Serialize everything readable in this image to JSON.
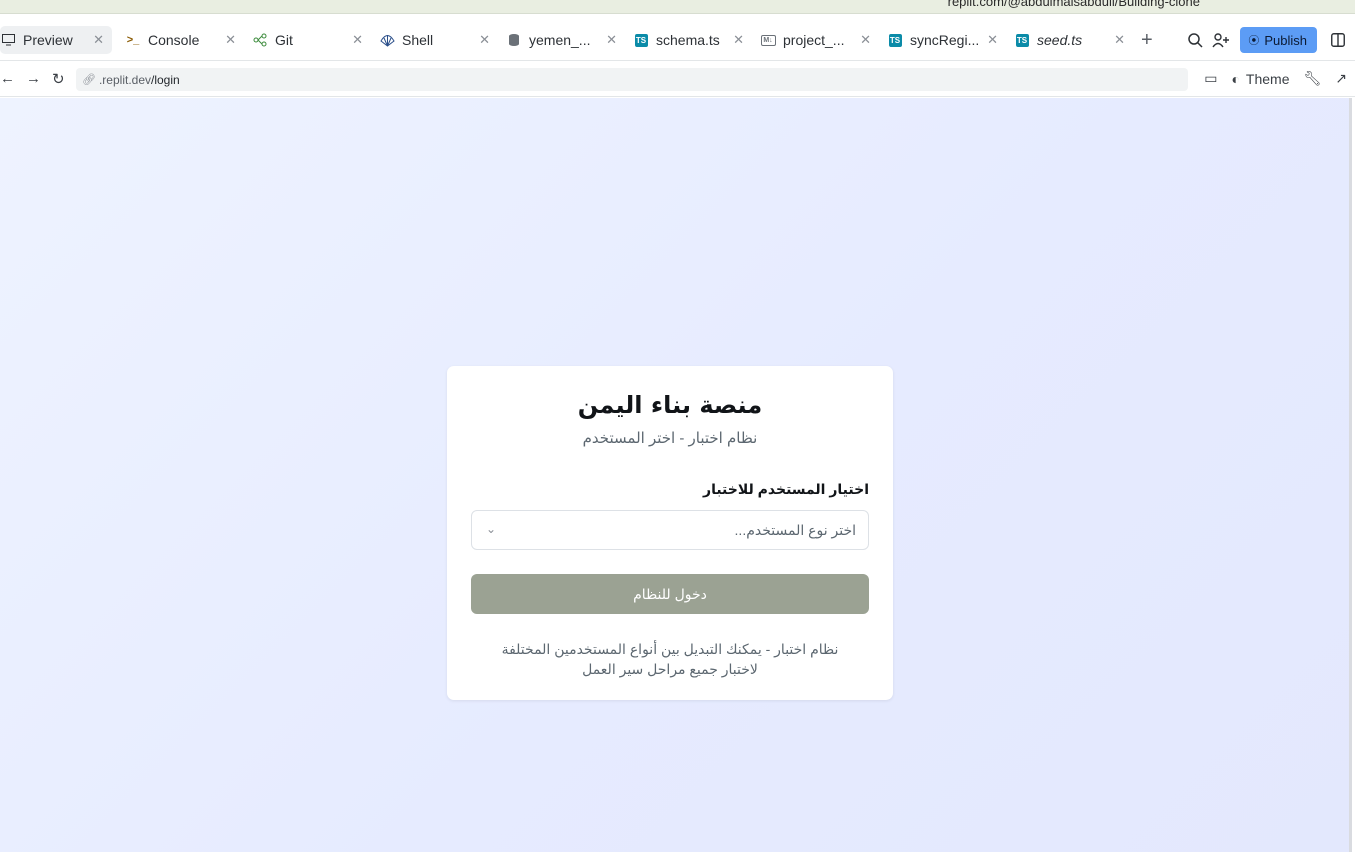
{
  "browser": {
    "url_top": "replit.com/@abdulmalsabdull/Building-clone",
    "tabs": [
      {
        "label": "Preview",
        "icon": "monitor-icon",
        "active": true
      },
      {
        "label": "Console",
        "icon": "terminal-icon"
      },
      {
        "label": "Git",
        "icon": "git-icon"
      },
      {
        "label": "Shell",
        "icon": "shell-icon"
      },
      {
        "label": "yemen_...",
        "icon": "database-icon"
      },
      {
        "label": "schema.ts",
        "icon": "ts-file-icon"
      },
      {
        "label": "project_...",
        "icon": "markdown-file-icon"
      },
      {
        "label": "syncRegi...",
        "icon": "ts-file-icon"
      },
      {
        "label": "seed.ts",
        "icon": "ts-file-icon",
        "italic": true
      }
    ],
    "publish_label": "Publish",
    "address": {
      "prefix": ".replit.dev",
      "path": "/login"
    },
    "theme_label": "Theme"
  },
  "login": {
    "title": "منصة بناء اليمن",
    "subtitle": "نظام اختبار - اختر المستخدم",
    "field_label": "اختيار المستخدم للاختبار",
    "select_placeholder": "اختر نوع المستخدم...",
    "submit_label": "دخول للنظام",
    "note_line1": "نظام اختبار - يمكنك التبديل بين أنواع المستخدمين المختلفة",
    "note_line2": "لاختبار جميع مراحل سير العمل"
  },
  "colors": {
    "accent": "#5c9cf5",
    "submit_disabled": "#9ba293",
    "viewport_bg": "#e8edff"
  }
}
